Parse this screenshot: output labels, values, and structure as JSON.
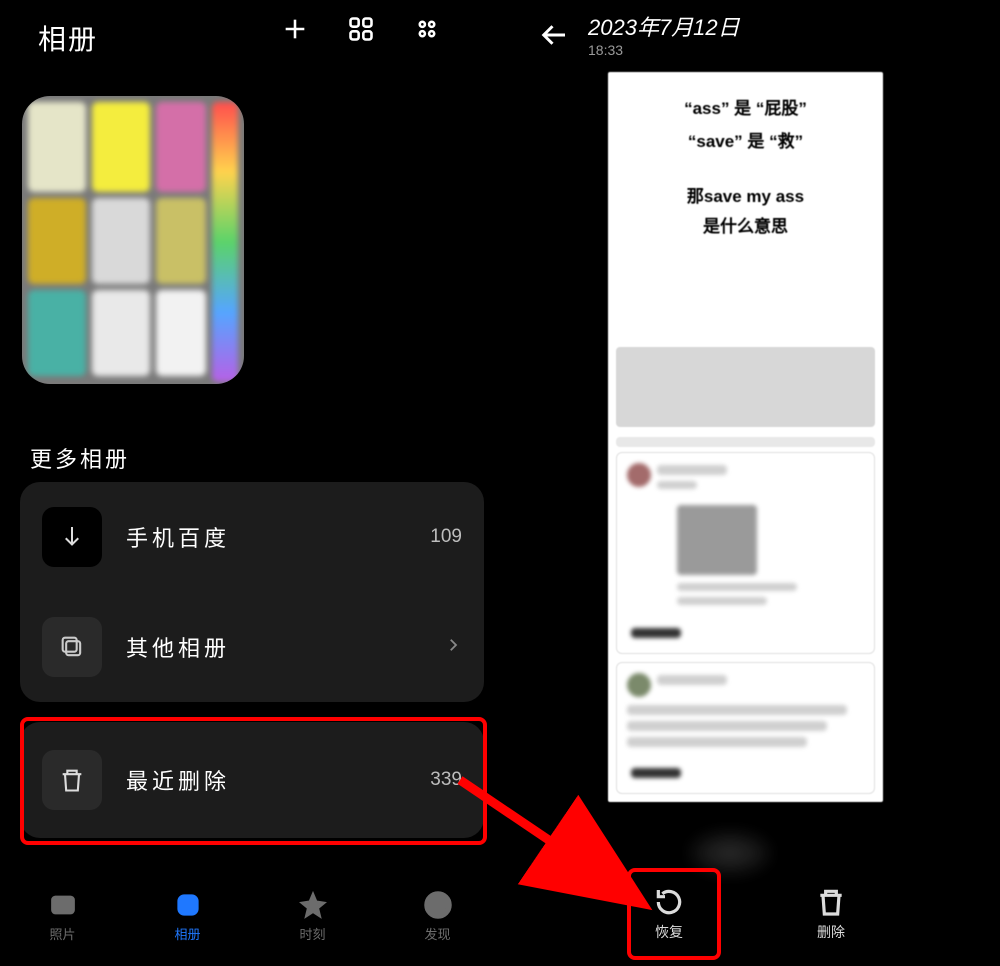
{
  "left": {
    "title": "相册",
    "more_title": "更多相册",
    "items": [
      {
        "label": "手机百度",
        "count": "109"
      },
      {
        "label": "其他相册",
        "count": ""
      }
    ],
    "recent_deleted": {
      "label": "最近删除",
      "count": "339"
    },
    "tabs": [
      {
        "label": "照片"
      },
      {
        "label": "相册"
      },
      {
        "label": "时刻"
      },
      {
        "label": "发现"
      }
    ]
  },
  "right": {
    "date": "2023年7月12日",
    "time": "18:33",
    "image_text": {
      "l1": "“ass” 是 “屁股”",
      "l2": "“save” 是 “救”",
      "l3": "那save my ass",
      "l4": "是什么意思"
    },
    "actions": {
      "restore": "恢复",
      "delete": "删除"
    }
  }
}
